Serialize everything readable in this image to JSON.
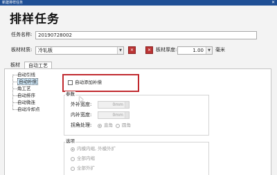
{
  "window": {
    "title": "新建排样任务",
    "close_glyph": "✕"
  },
  "heading": "排样任务",
  "task_name": {
    "label": "任务名称:",
    "value": "20190728002"
  },
  "material": {
    "label": "板材材质:",
    "value": "冷轧板",
    "dd_glyph": "▼",
    "clear_glyph": "✕"
  },
  "thickness": {
    "label": "板材厚度:",
    "value": "1.00",
    "unit": "毫米",
    "dd_glyph": "▼",
    "clear_glyph": "✕"
  },
  "tabs": [
    {
      "label": "板材"
    },
    {
      "label": "自动工艺"
    }
  ],
  "tree": [
    {
      "label": "自动引线"
    },
    {
      "label": "自动补偿"
    },
    {
      "label": "角工艺"
    },
    {
      "label": "自动排序"
    },
    {
      "label": "自动微连"
    },
    {
      "label": "自动冷却点"
    }
  ],
  "auto_comp": {
    "label": "自动添加补偿",
    "checked": false
  },
  "params": {
    "title": "参数",
    "outer": {
      "label": "外补宽度:",
      "value": "0mm"
    },
    "inner": {
      "label": "内补宽度:",
      "value": "0mm"
    },
    "corner": {
      "label": "拐角处理:",
      "options": [
        "直角",
        "圆角"
      ],
      "selected": "直角"
    }
  },
  "options": {
    "title": "选项",
    "items": [
      "内模内缩, 外模外扩",
      "全部内缩",
      "全部外扩"
    ],
    "selected": "内模内缩, 外模外扩"
  }
}
